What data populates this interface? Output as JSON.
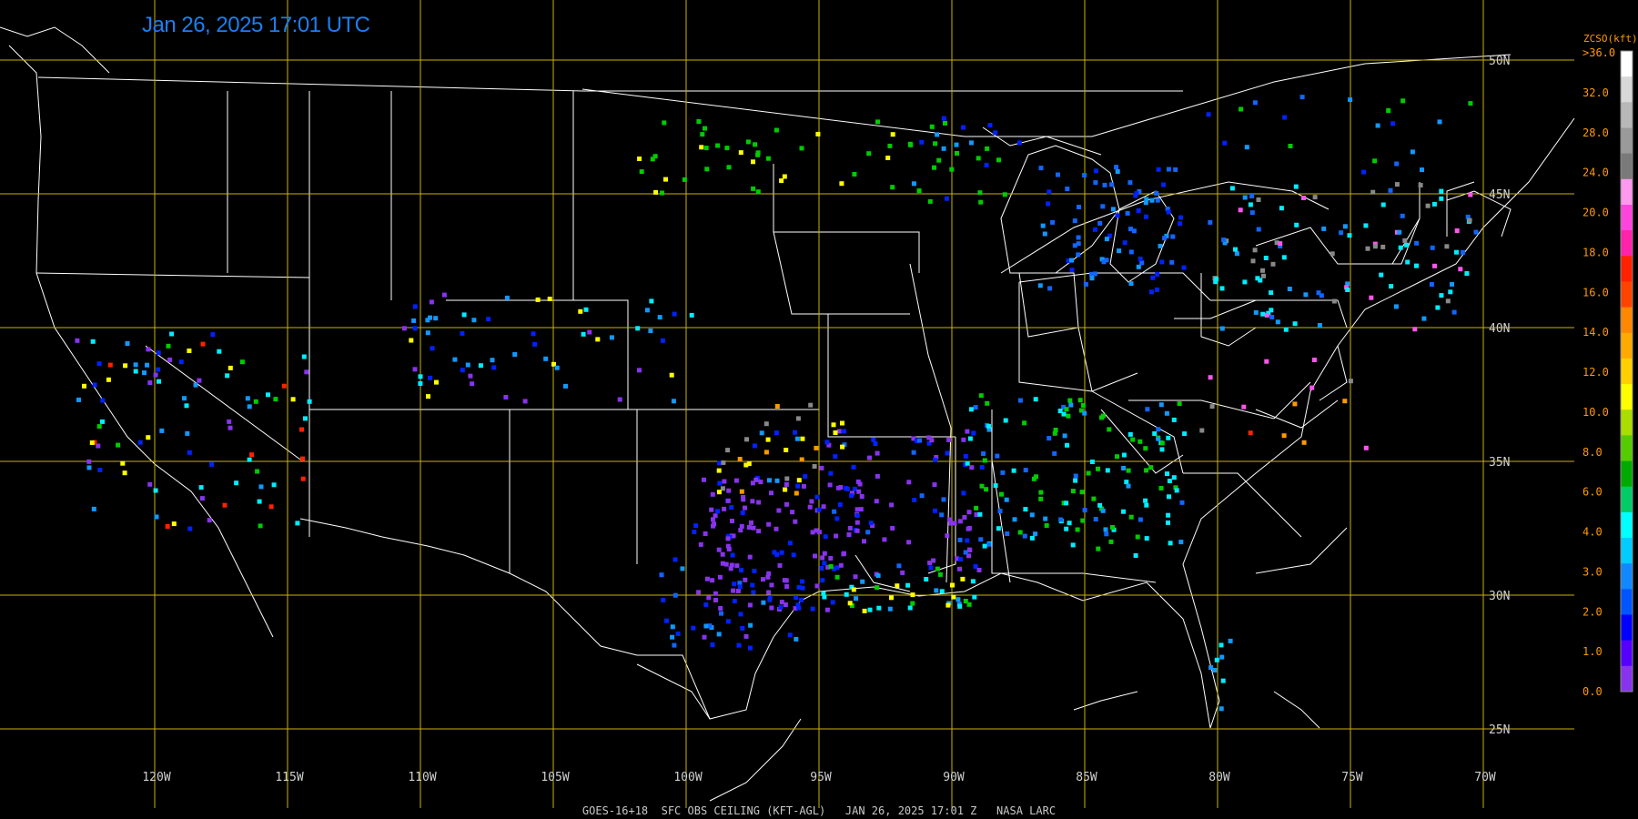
{
  "timestamp": "Jan 26, 2025 17:01 UTC",
  "footer": "GOES-16+18  SFC OBS CEILING (KFT-AGL)   JAN 26, 2025 17:01 Z   NASA LARC",
  "grid": {
    "lon_labels": [
      "120W",
      "115W",
      "110W",
      "105W",
      "100W",
      "95W",
      "90W",
      "85W",
      "80W",
      "75W",
      "70W"
    ],
    "lat_labels": [
      "50N",
      "45N",
      "40N",
      "35N",
      "30N",
      "25N"
    ],
    "line_color": "#c8b400",
    "label_color": "#d0d0d0"
  },
  "legend": {
    "title": "ZCSO(kft)",
    "labels": [
      ">36.0",
      "32.0",
      "28.0",
      "24.0",
      "20.0",
      "18.0",
      "16.0",
      "14.0",
      "12.0",
      "10.0",
      "8.0",
      "6.0",
      "4.0",
      "3.0",
      "2.0",
      "1.0",
      "0.0"
    ],
    "title_color": "#ff9900",
    "label_color": "#ff9900",
    "colors": [
      "#ffffff",
      "#d8d8d8",
      "#b8b8b8",
      "#9a9a9a",
      "#7a7a7a",
      "#ff99ee",
      "#ff44dd",
      "#ff22aa",
      "#ff2200",
      "#ff4400",
      "#ff8800",
      "#ffaa00",
      "#ffd000",
      "#ffff00",
      "#aadd00",
      "#55cc00",
      "#00aa00",
      "#00cc66",
      "#00ffff",
      "#00ccff",
      "#1188ff",
      "#0055ff",
      "#0000ff",
      "#5500ff",
      "#8833ee"
    ]
  },
  "stations_legend_colors": {
    "purple": "#8833ee",
    "blue": "#0022ff",
    "midblue": "#1166ff",
    "lightblue": "#1199ff",
    "cyan": "#00eeff",
    "green": "#00cc00",
    "yellow": "#ffff00",
    "orange": "#ff9900",
    "red": "#ff2200",
    "pink": "#ff55ee",
    "gray": "#888888"
  }
}
